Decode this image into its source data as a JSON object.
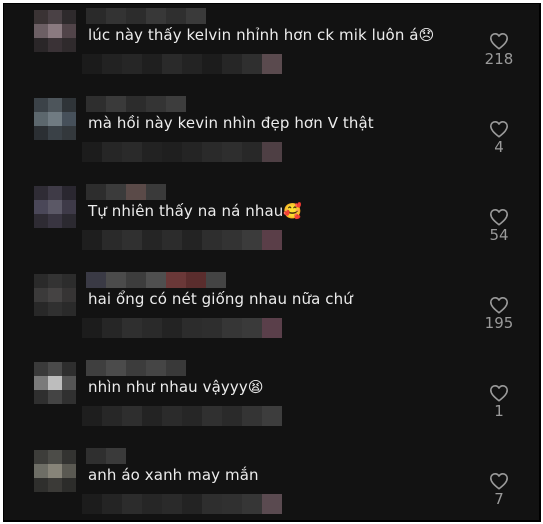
{
  "comments": [
    {
      "text": "lúc này thấy kelvin nhỉnh hơn ck mik luôn á",
      "emoji": "😞",
      "likes": "218",
      "avatar": [
        "#3a3334",
        "#4a4145",
        "#2e2a2c",
        "#6c5f64",
        "#8a7a80",
        "#514449",
        "#2a2628",
        "#3a3236",
        "#2f2a2c"
      ]
    },
    {
      "text": "mà hồi này kevin nhìn đẹp hơn V thật",
      "emoji": "",
      "likes": "4",
      "avatar": [
        "#3b4248",
        "#4d555b",
        "#2f3438",
        "#5c676d",
        "#707b82",
        "#46505a",
        "#2b2f33",
        "#3a4147",
        "#33383c"
      ]
    },
    {
      "text": "Tự nhiên thấy na ná nhau",
      "emoji": "🥰",
      "likes": "54",
      "avatar": [
        "#2f2c35",
        "#3f3b47",
        "#2a2730",
        "#4a4758",
        "#5b5866",
        "#3e3a48",
        "#2e2b33",
        "#393541",
        "#2b2930"
      ]
    },
    {
      "text": "hai ổng có nét giống nhau nữa chứ",
      "emoji": "",
      "likes": "195",
      "avatar": [
        "#2a2a2a",
        "#333333",
        "#2c2c2c",
        "#3b3a3a",
        "#454343",
        "#363434",
        "#282828",
        "#303030",
        "#2a2a2a"
      ]
    },
    {
      "text": "nhìn như nhau vậyyy",
      "emoji": "😫",
      "likes": "1",
      "avatar": [
        "#3a3a3a",
        "#4a4a4a",
        "#2e2e2e",
        "#7a7a7a",
        "#bdbdbd",
        "#555555",
        "#2f2f2f",
        "#444444",
        "#303030"
      ]
    },
    {
      "text": "anh áo xanh may mắn",
      "emoji": "",
      "likes": "7",
      "avatar": [
        "#3d3d3a",
        "#4c4c48",
        "#333331",
        "#6e6e66",
        "#878479",
        "#5a5952",
        "#2f2f2d",
        "#3b3a37",
        "#2c2c2a"
      ]
    }
  ],
  "colors": {
    "background": "#121212",
    "text": "#ececec",
    "muted": "#9a9a9a",
    "frame": "#000000"
  },
  "icons": {
    "like": "heart-outline-icon"
  }
}
